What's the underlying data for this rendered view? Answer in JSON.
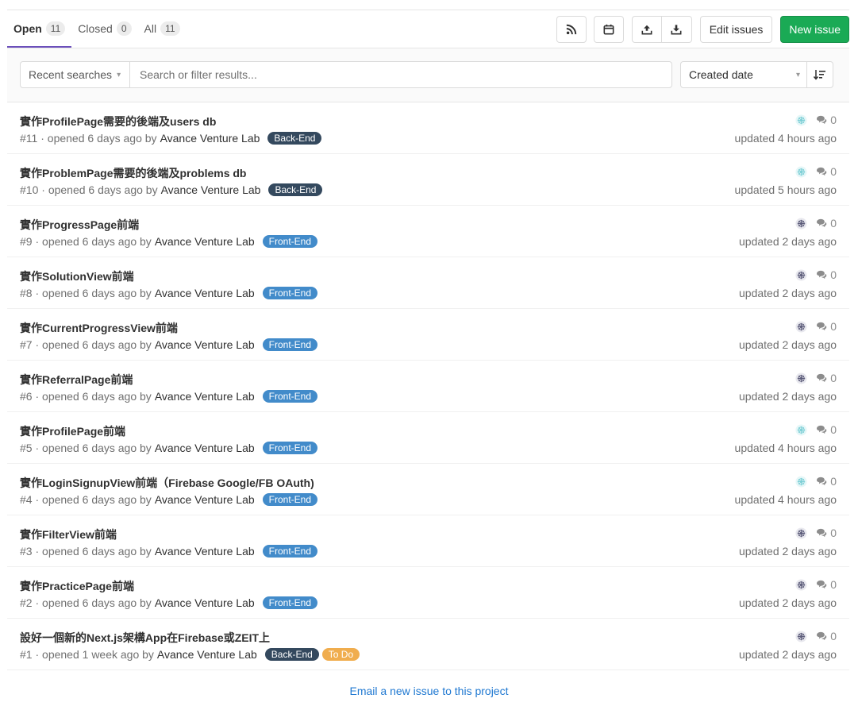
{
  "tabs": [
    {
      "label": "Open",
      "count": "11"
    },
    {
      "label": "Closed",
      "count": "0"
    },
    {
      "label": "All",
      "count": "11"
    }
  ],
  "toolbar": {
    "edit_label": "Edit issues",
    "new_label": "New issue",
    "new_color": "#1aaa55"
  },
  "filter": {
    "recent_label": "Recent searches",
    "search_placeholder": "Search or filter results...",
    "sort_label": "Created date"
  },
  "label_colors": {
    "Back-End": "#34495e",
    "Front-End": "#428bca",
    "To Do": "#f0ad4e"
  },
  "issues": [
    {
      "title": "實作ProfilePage需要的後端及users db",
      "ref": "#11",
      "opened": "opened 6 days ago by",
      "author": "Avance Venture Lab",
      "labels": [
        "Back-End"
      ],
      "comments": "0",
      "updated": "updated 4 hours ago",
      "avatar": "light"
    },
    {
      "title": "實作ProblemPage需要的後端及problems db",
      "ref": "#10",
      "opened": "opened 6 days ago by",
      "author": "Avance Venture Lab",
      "labels": [
        "Back-End"
      ],
      "comments": "0",
      "updated": "updated 5 hours ago",
      "avatar": "light"
    },
    {
      "title": "實作ProgressPage前端",
      "ref": "#9",
      "opened": "opened 6 days ago by",
      "author": "Avance Venture Lab",
      "labels": [
        "Front-End"
      ],
      "comments": "0",
      "updated": "updated 2 days ago",
      "avatar": "dark"
    },
    {
      "title": "實作SolutionView前端",
      "ref": "#8",
      "opened": "opened 6 days ago by",
      "author": "Avance Venture Lab",
      "labels": [
        "Front-End"
      ],
      "comments": "0",
      "updated": "updated 2 days ago",
      "avatar": "dark"
    },
    {
      "title": "實作CurrentProgressView前端",
      "ref": "#7",
      "opened": "opened 6 days ago by",
      "author": "Avance Venture Lab",
      "labels": [
        "Front-End"
      ],
      "comments": "0",
      "updated": "updated 2 days ago",
      "avatar": "dark"
    },
    {
      "title": "實作ReferralPage前端",
      "ref": "#6",
      "opened": "opened 6 days ago by",
      "author": "Avance Venture Lab",
      "labels": [
        "Front-End"
      ],
      "comments": "0",
      "updated": "updated 2 days ago",
      "avatar": "dark"
    },
    {
      "title": "實作ProfilePage前端",
      "ref": "#5",
      "opened": "opened 6 days ago by",
      "author": "Avance Venture Lab",
      "labels": [
        "Front-End"
      ],
      "comments": "0",
      "updated": "updated 4 hours ago",
      "avatar": "light"
    },
    {
      "title": "實作LoginSignupView前端（Firebase Google/FB OAuth)",
      "ref": "#4",
      "opened": "opened 6 days ago by",
      "author": "Avance Venture Lab",
      "labels": [
        "Front-End"
      ],
      "comments": "0",
      "updated": "updated 4 hours ago",
      "avatar": "light"
    },
    {
      "title": "實作FilterView前端",
      "ref": "#3",
      "opened": "opened 6 days ago by",
      "author": "Avance Venture Lab",
      "labels": [
        "Front-End"
      ],
      "comments": "0",
      "updated": "updated 2 days ago",
      "avatar": "dark"
    },
    {
      "title": "實作PracticePage前端",
      "ref": "#2",
      "opened": "opened 6 days ago by",
      "author": "Avance Venture Lab",
      "labels": [
        "Front-End"
      ],
      "comments": "0",
      "updated": "updated 2 days ago",
      "avatar": "dark"
    },
    {
      "title": "設好一個新的Next.js架構App在Firebase或ZEIT上",
      "ref": "#1",
      "opened": "opened 1 week ago by",
      "author": "Avance Venture Lab",
      "labels": [
        "Back-End",
        "To Do"
      ],
      "comments": "0",
      "updated": "updated 2 days ago",
      "avatar": "dark"
    }
  ],
  "footer": {
    "email_link": "Email a new issue to this project"
  }
}
